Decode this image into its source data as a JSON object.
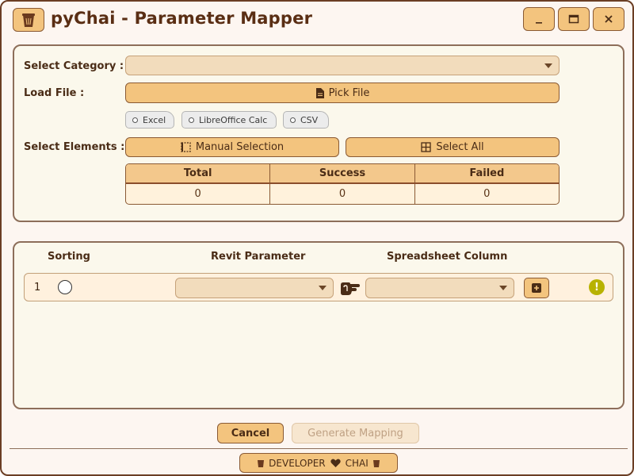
{
  "window": {
    "title": "pyChai - Parameter Mapper",
    "controls": {
      "minimize": "_",
      "maximize": "▭",
      "close": "✕"
    }
  },
  "form": {
    "category_label": "Select Category :",
    "category_value": "",
    "load_file_label": "Load File :",
    "pick_file_label": "Pick File",
    "file_types": [
      "Excel",
      "LibreOffice Calc",
      "CSV"
    ],
    "select_elements_label": "Select Elements :",
    "manual_selection_label": "Manual Selection",
    "select_all_label": "Select All"
  },
  "stats": {
    "headers": [
      "Total",
      "Success",
      "Failed"
    ],
    "values": [
      "0",
      "0",
      "0"
    ]
  },
  "mapping": {
    "headers": {
      "sorting": "Sorting",
      "revit_parameter": "Revit Parameter",
      "spreadsheet_column": "Spreadsheet Column"
    },
    "rows": [
      {
        "index": "1",
        "revit_parameter": "",
        "spreadsheet_column": "",
        "status": "warning"
      }
    ]
  },
  "footer": {
    "cancel_label": "Cancel",
    "generate_label": "Generate Mapping",
    "developer_left": "DEVELOPER",
    "developer_right": "CHAI"
  },
  "colors": {
    "accent": "#f3c47e",
    "border": "#8a5a34",
    "background": "#fdf6f1",
    "warning": "#b8b200"
  }
}
